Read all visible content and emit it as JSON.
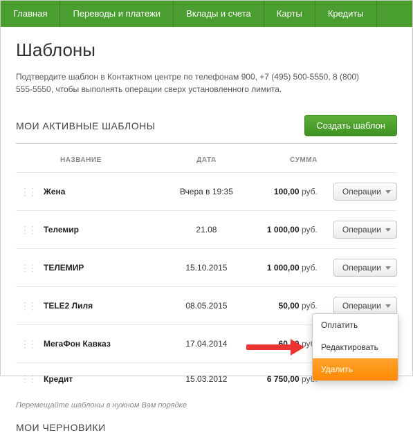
{
  "nav": [
    "Главная",
    "Переводы и платежи",
    "Вклады и счета",
    "Карты",
    "Кредиты"
  ],
  "title": "Шаблоны",
  "note": "Подтвердите шаблон в Контактном центре по телефонам 900, +7 (495) 500-5550, 8 (800) 555-5550, чтобы выполнять операции сверх установленного лимита.",
  "section_title": "МОИ АКТИВНЫЕ ШАБЛОНЫ",
  "create_btn": "Создать шаблон",
  "cols": {
    "name": "НАЗВАНИЕ",
    "date": "ДАТА",
    "sum": "СУММА"
  },
  "ops_label": "Операции",
  "currency": "руб.",
  "templates": [
    {
      "name": "Жена",
      "date": "Вчера в 19:35",
      "sum": "100,00"
    },
    {
      "name": "Телемир",
      "date": "21.08",
      "sum": "1 000,00"
    },
    {
      "name": "ТЕЛЕМИР",
      "date": "15.10.2015",
      "sum": "1 000,00"
    },
    {
      "name": "TELE2 Лиля",
      "date": "08.05.2015",
      "sum": "50,00"
    },
    {
      "name": "МегаФон Кавказ",
      "date": "17.04.2014",
      "sum": "60,00"
    },
    {
      "name": "Кредит",
      "date": "15.03.2012",
      "sum": "6 750,00"
    }
  ],
  "menu": {
    "pay": "Оплатить",
    "edit": "Редактировать",
    "del": "Удалить"
  },
  "hint": "Перемещайте шаблоны в нужном Вам порядке",
  "section2": "МОИ ЧЕРНОВИКИ"
}
